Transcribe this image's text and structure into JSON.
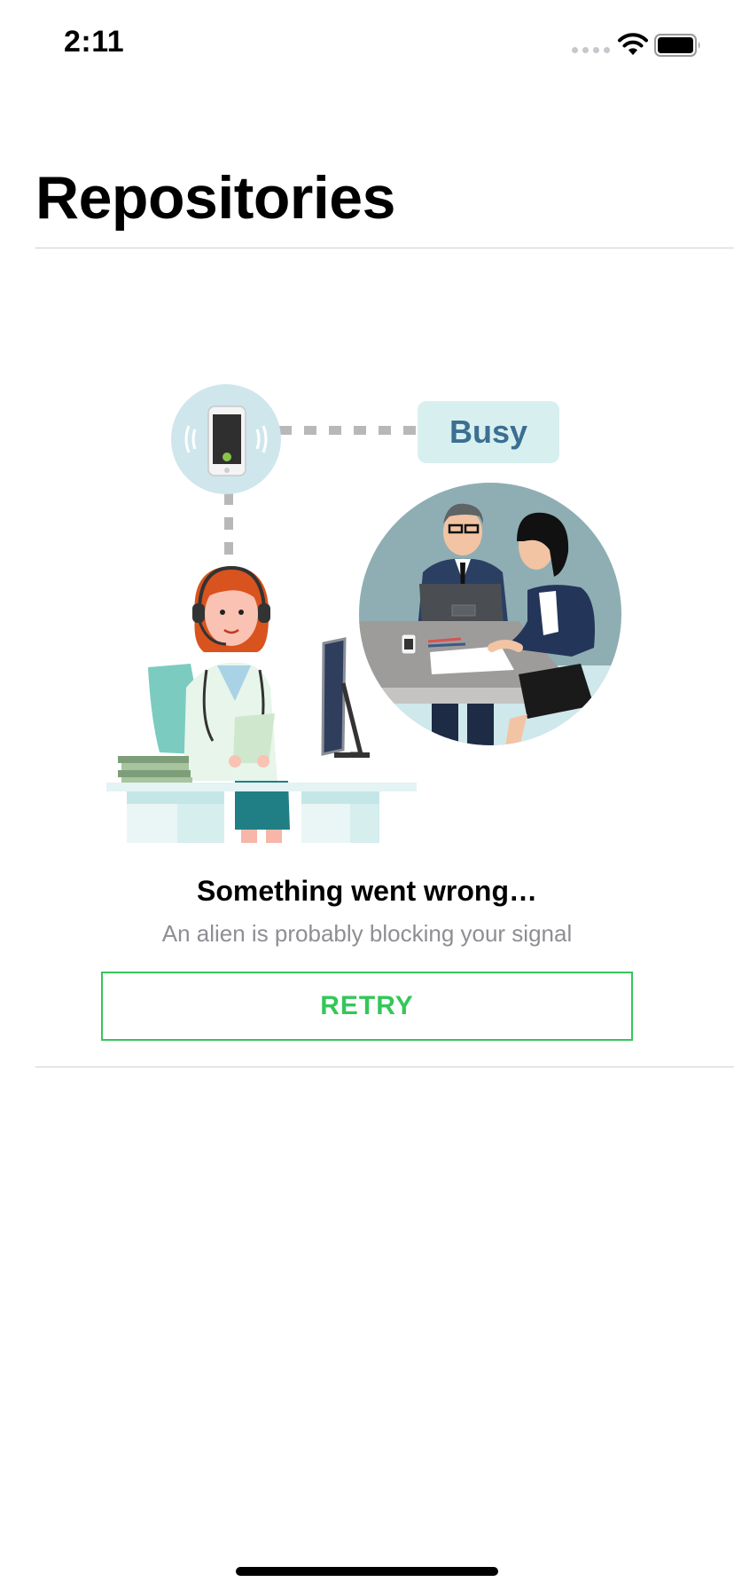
{
  "status_bar": {
    "time": "2:11",
    "icons": [
      "cellular-signal-icon",
      "wifi-icon",
      "battery-icon"
    ]
  },
  "header": {
    "title": "Repositories"
  },
  "illustration": {
    "badge": "Busy",
    "icon_names": [
      "phone-icon",
      "call-center-agent",
      "meeting-scene"
    ]
  },
  "error": {
    "title": "Something went wrong…",
    "subtitle": "An alien is probably blocking your signal",
    "retry_label": "RETRY"
  },
  "colors": {
    "accent": "#34c759",
    "subtitle": "#8e8e93",
    "badge_bg": "#d8eff0",
    "badge_text": "#3b6f92",
    "phone_circle": "#cfe6ec"
  }
}
